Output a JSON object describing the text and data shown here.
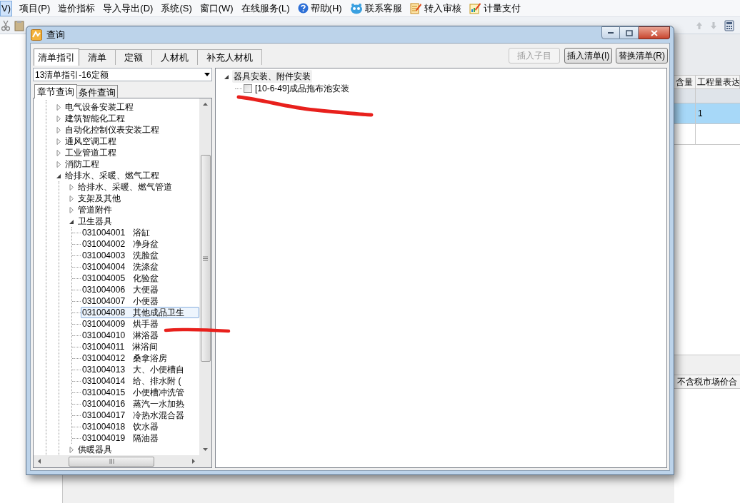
{
  "menu": [
    {
      "label": "V)",
      "selected": true
    },
    {
      "label": "项目(P)",
      "selected": false
    },
    {
      "label": "造价指标",
      "selected": false
    },
    {
      "label": "导入导出(D)",
      "selected": false
    },
    {
      "label": "系统(S)",
      "selected": false
    },
    {
      "label": "窗口(W)",
      "selected": false
    },
    {
      "label": "在线服务(L)",
      "selected": false
    },
    {
      "label": "帮助(H)",
      "selected": false,
      "kind": "icon"
    },
    {
      "label": "联系客服",
      "selected": false,
      "kind": "icon"
    },
    {
      "label": "转入审核",
      "selected": false,
      "kind": "icon"
    },
    {
      "label": "计量支付",
      "selected": false,
      "kind": "icon"
    }
  ],
  "background_table": {
    "columns": [
      "含量",
      "工程量表达"
    ],
    "rows": [
      {
        "kind": "filter",
        "selected": false
      },
      {
        "kind": "data",
        "selected": true,
        "column_2": "1"
      },
      {
        "kind": "data",
        "selected": false
      }
    ]
  },
  "lower_panel": {
    "header": "不含税市场价合"
  },
  "dialog": {
    "title": "查询",
    "tabs": [
      {
        "label": "清单指引",
        "selected": true
      },
      {
        "label": "清单",
        "selected": false
      },
      {
        "label": "定额",
        "selected": false
      },
      {
        "label": "人材机",
        "selected": false
      },
      {
        "label": "补充人材机",
        "selected": false
      }
    ],
    "buttons": [
      {
        "label": "插入子目",
        "disabled": true
      },
      {
        "label": "插入清单(I)",
        "disabled": false
      },
      {
        "label": "替换清单(R)",
        "disabled": false
      }
    ],
    "library": "13清单指引-16定额",
    "subtabs": [
      {
        "label": "章节查询",
        "selected": true
      },
      {
        "label": "条件查询",
        "selected": false
      }
    ],
    "tree": [
      {
        "label": "电气设备安装工程",
        "expanded": false,
        "selected": false
      },
      {
        "label": "建筑智能化工程",
        "expanded": false,
        "selected": false
      },
      {
        "label": "自动化控制仪表安装工程",
        "expanded": false,
        "selected": false
      },
      {
        "label": "通风空调工程",
        "expanded": false,
        "selected": false
      },
      {
        "label": "工业管道工程",
        "expanded": false,
        "selected": false
      },
      {
        "label": "消防工程",
        "expanded": false,
        "selected": false
      },
      {
        "label": "给排水、采暖、燃气工程",
        "expanded": true,
        "selected": false,
        "children": [
          {
            "label": "给排水、采暖、燃气管道",
            "expanded": false,
            "selected": false
          },
          {
            "label": "支架及其他",
            "expanded": false,
            "selected": false
          },
          {
            "label": "管道附件",
            "expanded": false,
            "selected": false
          },
          {
            "label": "卫生器具",
            "expanded": true,
            "selected": false,
            "children": [
              {
                "code": "031004001",
                "name": "浴缸",
                "selected": false
              },
              {
                "code": "031004002",
                "name": "净身盆",
                "selected": false
              },
              {
                "code": "031004003",
                "name": "洗脸盆",
                "selected": false
              },
              {
                "code": "031004004",
                "name": "洗涤盆",
                "selected": false
              },
              {
                "code": "031004005",
                "name": "化验盆",
                "selected": false
              },
              {
                "code": "031004006",
                "name": "大便器",
                "selected": false
              },
              {
                "code": "031004007",
                "name": "小便器",
                "selected": false
              },
              {
                "code": "031004008",
                "name": "其他成品卫生",
                "selected": true
              },
              {
                "code": "031004009",
                "name": "烘手器",
                "selected": false
              },
              {
                "code": "031004010",
                "name": "淋浴器",
                "selected": false
              },
              {
                "code": "031004011",
                "name": "淋浴间",
                "selected": false
              },
              {
                "code": "031004012",
                "name": "桑拿浴房",
                "selected": false
              },
              {
                "code": "031004013",
                "name": "大、小便槽自",
                "selected": false
              },
              {
                "code": "031004014",
                "name": "给、排水附 (",
                "selected": false
              },
              {
                "code": "031004015",
                "name": "小便槽冲洗管",
                "selected": false
              },
              {
                "code": "031004016",
                "name": "蒸汽一水加热",
                "selected": false
              },
              {
                "code": "031004017",
                "name": "冷热水混合器",
                "selected": false
              },
              {
                "code": "031004018",
                "name": "饮水器",
                "selected": false
              },
              {
                "code": "031004019",
                "name": "隔油器",
                "selected": false
              }
            ]
          },
          {
            "label": "供暖器具",
            "expanded": false,
            "selected": false
          }
        ]
      }
    ],
    "result_tree": [
      {
        "label": "器具安装、附件安装",
        "expanded": true,
        "children": [
          {
            "label": "[10-6-49]成品拖布池安装",
            "checked": false
          }
        ]
      }
    ]
  }
}
